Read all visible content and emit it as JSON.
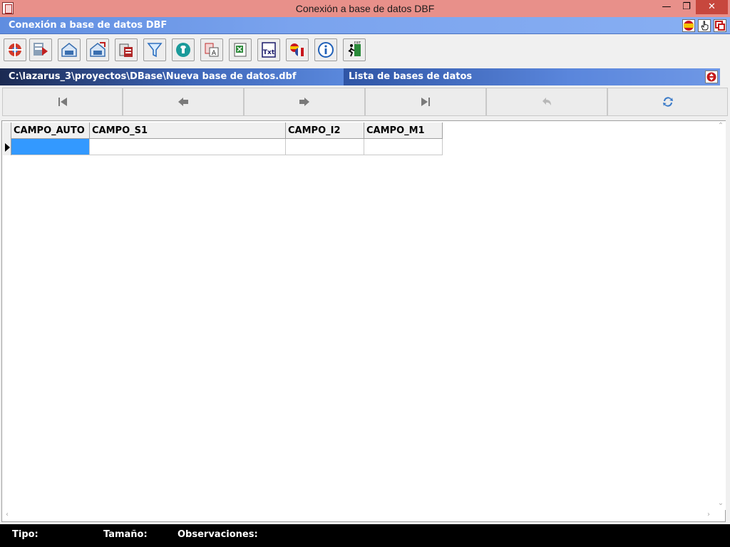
{
  "window": {
    "title": "Conexión a base de datos DBF",
    "minimize_glyph": "—",
    "restore_glyph": "❐",
    "close_glyph": "✕"
  },
  "header": {
    "title": "Conexión a base de datos DBF",
    "icons": [
      "spanish-flag-icon",
      "hand-pointer-icon",
      "cascade-windows-icon"
    ]
  },
  "toolbar": {
    "buttons": [
      {
        "name": "connect-database-icon",
        "color": "#d23a2a"
      },
      {
        "name": "table-structure-icon",
        "color": "#5a7a9a"
      },
      {
        "name": "open-folder-icon",
        "color": "#3a6fb0"
      },
      {
        "name": "save-folder-icon",
        "color": "#3a6fb0"
      },
      {
        "name": "delete-records-icon",
        "color": "#b02828"
      },
      {
        "name": "filter-icon",
        "color": "#2f70c0"
      },
      {
        "name": "teal-shirt-icon",
        "color": "#1a9a9a"
      },
      {
        "name": "text-document-icon",
        "color": "#c03030"
      },
      {
        "name": "excel-export-icon",
        "color": "#2d8a3a"
      },
      {
        "name": "txt-export-icon",
        "color": "#1a1a6a"
      },
      {
        "name": "language-flags-icon",
        "color": "#d88a2a"
      },
      {
        "name": "info-icon",
        "color": "#2060b8"
      },
      {
        "name": "exit-icon",
        "color": "#2a8a3a"
      }
    ]
  },
  "path_bar": {
    "path": "C:\\lazarus_3\\proyectos\\DBase\\Nueva base de datos.dbf",
    "list_title": "Lista de bases de datos"
  },
  "grid": {
    "columns": [
      "CAMPO_AUTO",
      "CAMPO_S1",
      "CAMPO_I2",
      "CAMPO_M1"
    ],
    "selected_cell_color": "#3399ff"
  },
  "status": {
    "tipo_label": "Tipo:",
    "tamano_label": "Tamaño:",
    "observaciones_label": "Observaciones:"
  }
}
